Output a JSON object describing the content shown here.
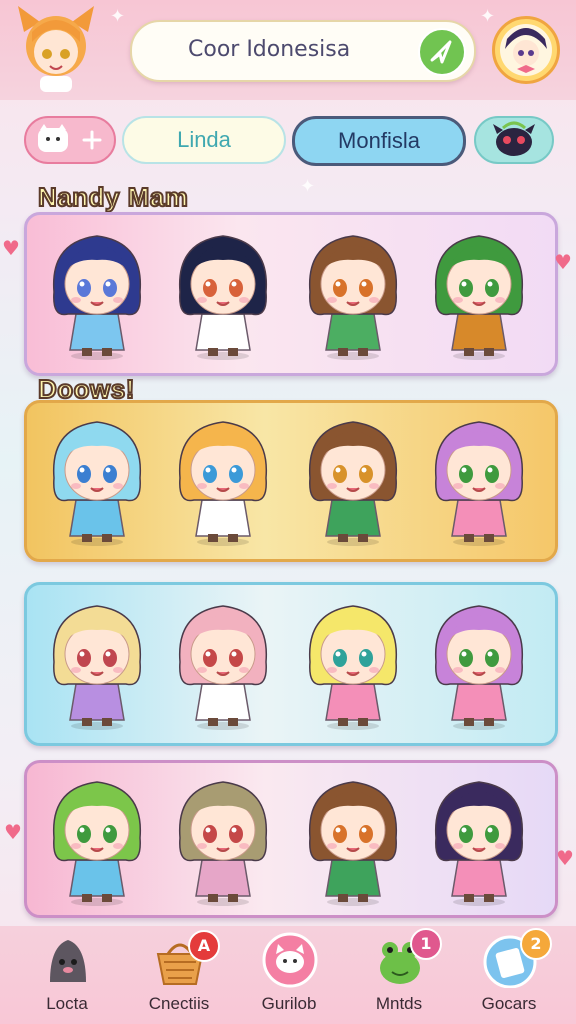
{
  "header": {
    "search_text": "Coor Idonesisa"
  },
  "tabs": [
    {
      "label": ""
    },
    {
      "label": "Linda"
    },
    {
      "label": "Monfisla"
    },
    {
      "label": ""
    }
  ],
  "sections": [
    {
      "title": "Nandy Mam"
    },
    {
      "title": "Doows!"
    }
  ],
  "colors": {
    "accent_pink": "#f06a8a",
    "tab_active": "#8ed6f2",
    "search_go": "#71c451"
  },
  "rows": [
    {
      "characters": [
        {
          "hair": "#2e3a8f",
          "outfit": "#7cc6ef",
          "eye": "#5a78d8"
        },
        {
          "hair": "#1e2448",
          "outfit": "#ffffff",
          "eye": "#d8623a"
        },
        {
          "hair": "#8a5530",
          "outfit": "#4cae62",
          "eye": "#d8722a"
        },
        {
          "hair": "#3f9a3e",
          "outfit": "#d7892a",
          "eye": "#3f9a3e"
        }
      ]
    },
    {
      "characters": [
        {
          "hair": "#8fd9ef",
          "outfit": "#6ac3ea",
          "eye": "#3b7fd1"
        },
        {
          "hair": "#f5b54c",
          "outfit": "#ffffff",
          "eye": "#3b9ad8"
        },
        {
          "hair": "#8a5530",
          "outfit": "#3ea35c",
          "eye": "#d8922a"
        },
        {
          "hair": "#c783d9",
          "outfit": "#f48fb8",
          "eye": "#3f9a3e"
        }
      ]
    },
    {
      "characters": [
        {
          "hair": "#f3dc95",
          "outfit": "#b88fe1",
          "eye": "#c0464f"
        },
        {
          "hair": "#f2b1bf",
          "outfit": "#ffffff",
          "eye": "#c54848"
        },
        {
          "hair": "#f5e76a",
          "outfit": "#f48fb8",
          "eye": "#2fa29a"
        },
        {
          "hair": "#c783d9",
          "outfit": "#f48fb8",
          "eye": "#3f9a3e"
        }
      ]
    },
    {
      "characters": [
        {
          "hair": "#7cc64a",
          "outfit": "#6ac3ea",
          "eye": "#3f9a3e"
        },
        {
          "hair": "#a89c72",
          "outfit": "#e6a6c8",
          "eye": "#c54848"
        },
        {
          "hair": "#8a5530",
          "outfit": "#3ea35c",
          "eye": "#d8722a"
        },
        {
          "hair": "#3a2a5e",
          "outfit": "#f48fb8",
          "eye": "#3f9a3e"
        }
      ]
    }
  ],
  "bottom_nav": [
    {
      "label": "Locta",
      "icon": "mole-icon",
      "badge": ""
    },
    {
      "label": "Cnectiis",
      "icon": "basket-icon",
      "badge": "A"
    },
    {
      "label": "Gurilob",
      "icon": "cat-face-icon",
      "badge": ""
    },
    {
      "label": "Mntds",
      "icon": "frog-icon",
      "badge": "1"
    },
    {
      "label": "Gocars",
      "icon": "card-icon",
      "badge": "2"
    }
  ]
}
